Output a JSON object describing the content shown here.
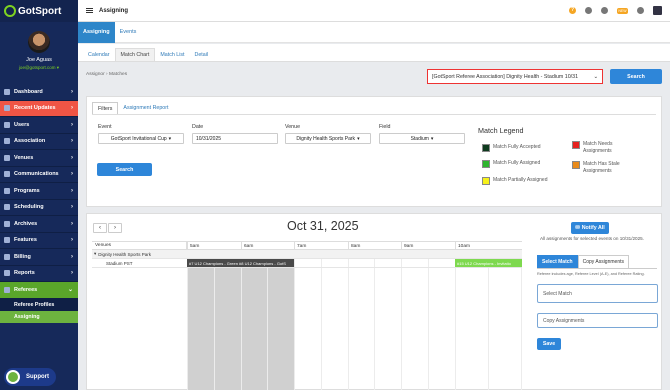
{
  "app": {
    "logo_text": "GotSport"
  },
  "profile": {
    "name": "Joe Aguas",
    "email": "joe@gotsport.com"
  },
  "sidebar": {
    "items": [
      {
        "label": "Dashboard",
        "icon": "dashboard-icon"
      },
      {
        "label": "Recent Updates",
        "icon": "bell-icon"
      },
      {
        "label": "Users",
        "icon": "users-icon"
      },
      {
        "label": "Association",
        "icon": "building-icon"
      },
      {
        "label": "Venues",
        "icon": "map-marker-icon"
      },
      {
        "label": "Communications",
        "icon": "envelope-icon"
      },
      {
        "label": "Programs",
        "icon": "programs-icon"
      },
      {
        "label": "Scheduling",
        "icon": "calendar-icon"
      },
      {
        "label": "Archives",
        "icon": "archive-icon"
      },
      {
        "label": "Features",
        "icon": "star-icon"
      },
      {
        "label": "Billing",
        "icon": "credit-card-icon"
      },
      {
        "label": "Reports",
        "icon": "chart-icon"
      },
      {
        "label": "Referees",
        "icon": "whistle-icon"
      }
    ],
    "sub_items": [
      {
        "label": "Referee Profiles"
      },
      {
        "label": "Assigning"
      }
    ],
    "support_label": "Support"
  },
  "topbar": {
    "title": "Assigning",
    "badge": "NEW"
  },
  "module_tabs": [
    {
      "label": "Assigning"
    },
    {
      "label": "Events"
    }
  ],
  "sub_tabs": [
    {
      "label": "Calendar"
    },
    {
      "label": "Match Chart"
    },
    {
      "label": "Match List"
    },
    {
      "label": "Detail"
    }
  ],
  "breadcrumb": {
    "first": "Assignor",
    "sep": "›",
    "second": "Matches"
  },
  "match_select": {
    "value": "[GotSport Referee Association] Dignity Health - Stadium 10/31"
  },
  "search_top_label": "Search",
  "filters": {
    "tabs": [
      {
        "label": "Filters"
      },
      {
        "label": "Assignment Report"
      }
    ],
    "event": {
      "label": "Event",
      "value": "GotSport Invitational Cup"
    },
    "date": {
      "label": "Date",
      "value": "10/31/2025"
    },
    "venue": {
      "label": "Venue",
      "value": "Dignity Health Sports Park"
    },
    "field": {
      "label": "Field",
      "value": "Stadium"
    },
    "search_label": "Search"
  },
  "legend": {
    "title": "Match Legend",
    "items": [
      {
        "label": "Match Fully Accepted",
        "color": "#0e3b1e"
      },
      {
        "label": "Match Fully Assigned",
        "color": "#2fb52f"
      },
      {
        "label": "Match Partially Assigned",
        "color": "#f7f21a"
      },
      {
        "label": "Match Needs Assignments",
        "color": "#e5211f"
      },
      {
        "label": "Match Has Stale Assignments",
        "color": "#e88a1a"
      }
    ]
  },
  "schedule": {
    "prev_label": "‹",
    "next_label": "›",
    "date_title": "Oct 31, 2025",
    "venues_header": "Venues",
    "hours": [
      "5am",
      "6am",
      "7am",
      "8am",
      "9am",
      "10am"
    ],
    "venue_group": "Dignity Health Sports Park",
    "field_row": "Stadium PST",
    "events": [
      {
        "label": "#7 U12 Champions - Green #8 U12 Champions - GotS",
        "color": "#4a4a4a"
      },
      {
        "label": "#15 U12 Champions - Invitatio",
        "color": "#7ed94f"
      }
    ]
  },
  "right_panel": {
    "notify_label": "Notify All",
    "note": "All assignments for selected events on 10/31/2025.",
    "tab_select": "Select Match",
    "tab_copy": "Copy Assignments",
    "hint": "Referee includes age, Referee Level (A-E), and Referee Rating.",
    "select_match_placeholder": "Select Match",
    "copy_placeholder": "Copy Assignments",
    "save_label": "Save"
  }
}
